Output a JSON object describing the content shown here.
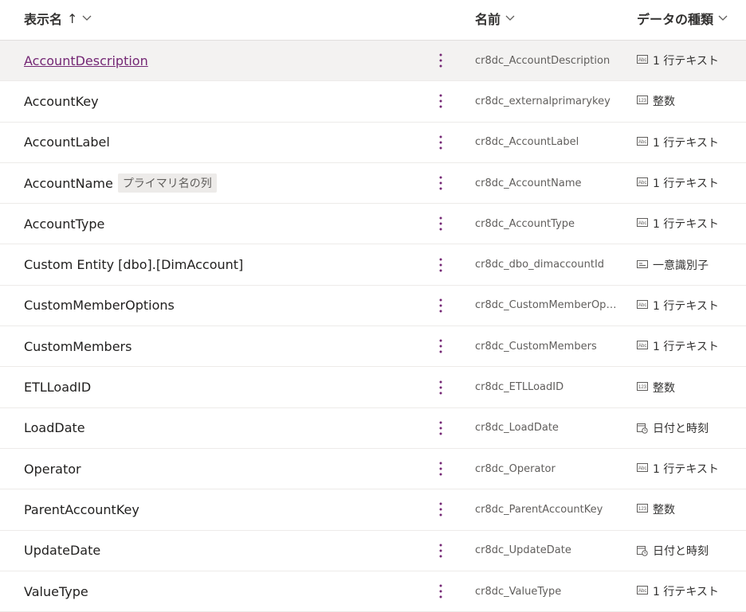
{
  "header": {
    "display_name": "表示名",
    "sort_arrow": "↑",
    "name": "名前",
    "data_type": "データの種類"
  },
  "colors": {
    "link": "#742774",
    "more_dots": "#742774",
    "selected_bg": "#f3f2f1"
  },
  "rows": [
    {
      "display": "AccountDescription",
      "badge": "",
      "name": "cr8dc_AccountDescription",
      "type": "1 行テキスト",
      "type_icon": "text-icon",
      "selected": true
    },
    {
      "display": "AccountKey",
      "badge": "",
      "name": "cr8dc_externalprimarykey",
      "type": "整数",
      "type_icon": "number-icon"
    },
    {
      "display": "AccountLabel",
      "badge": "",
      "name": "cr8dc_AccountLabel",
      "type": "1 行テキスト",
      "type_icon": "text-icon"
    },
    {
      "display": "AccountName",
      "badge": "プライマリ名の列",
      "name": "cr8dc_AccountName",
      "type": "1 行テキスト",
      "type_icon": "text-icon"
    },
    {
      "display": "AccountType",
      "badge": "",
      "name": "cr8dc_AccountType",
      "type": "1 行テキスト",
      "type_icon": "text-icon"
    },
    {
      "display": "Custom Entity [dbo].[DimAccount]",
      "badge": "",
      "name": "cr8dc_dbo_dimaccountId",
      "type": "一意識別子",
      "type_icon": "id-icon"
    },
    {
      "display": "CustomMemberOptions",
      "badge": "",
      "name": "cr8dc_CustomMemberOpti...",
      "type": "1 行テキスト",
      "type_icon": "text-icon"
    },
    {
      "display": "CustomMembers",
      "badge": "",
      "name": "cr8dc_CustomMembers",
      "type": "1 行テキスト",
      "type_icon": "text-icon"
    },
    {
      "display": "ETLLoadID",
      "badge": "",
      "name": "cr8dc_ETLLoadID",
      "type": "整数",
      "type_icon": "number-icon"
    },
    {
      "display": "LoadDate",
      "badge": "",
      "name": "cr8dc_LoadDate",
      "type": "日付と時刻",
      "type_icon": "datetime-icon"
    },
    {
      "display": "Operator",
      "badge": "",
      "name": "cr8dc_Operator",
      "type": "1 行テキスト",
      "type_icon": "text-icon"
    },
    {
      "display": "ParentAccountKey",
      "badge": "",
      "name": "cr8dc_ParentAccountKey",
      "type": "整数",
      "type_icon": "number-icon"
    },
    {
      "display": "UpdateDate",
      "badge": "",
      "name": "cr8dc_UpdateDate",
      "type": "日付と時刻",
      "type_icon": "datetime-icon"
    },
    {
      "display": "ValueType",
      "badge": "",
      "name": "cr8dc_ValueType",
      "type": "1 行テキスト",
      "type_icon": "text-icon"
    }
  ]
}
